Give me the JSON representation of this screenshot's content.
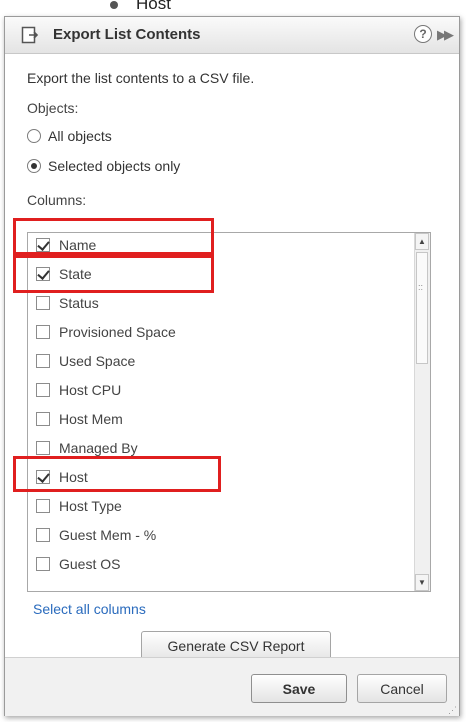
{
  "background": {
    "top_text": "Host"
  },
  "dialog": {
    "title": "Export List Contents",
    "help_glyph": "?",
    "expand_glyph": "▶▶",
    "description": "Export the list contents to a CSV file.",
    "objects_label": "Objects:",
    "objects_options": [
      {
        "label": "All objects",
        "selected": false
      },
      {
        "label": "Selected objects only",
        "selected": true
      }
    ],
    "columns_label": "Columns:",
    "columns": [
      {
        "label": "Name",
        "checked": true
      },
      {
        "label": "State",
        "checked": true
      },
      {
        "label": "Status",
        "checked": false
      },
      {
        "label": "Provisioned Space",
        "checked": false
      },
      {
        "label": "Used Space",
        "checked": false
      },
      {
        "label": "Host CPU",
        "checked": false
      },
      {
        "label": "Host Mem",
        "checked": false
      },
      {
        "label": "Managed By",
        "checked": false
      },
      {
        "label": "Host",
        "checked": true
      },
      {
        "label": "Host Type",
        "checked": false
      },
      {
        "label": "Guest Mem - %",
        "checked": false
      },
      {
        "label": "Guest OS",
        "checked": false
      }
    ],
    "select_all_link": "Select all columns",
    "generate_button": "Generate CSV Report",
    "save_button": "Save",
    "cancel_button": "Cancel"
  },
  "colors": {
    "highlight": "#e01f1f",
    "link": "#2a6bbd"
  },
  "icons": [
    "export-icon",
    "help-icon",
    "expand-icon",
    "scroll-up-icon",
    "scroll-down-icon",
    "resize-grip-icon"
  ]
}
